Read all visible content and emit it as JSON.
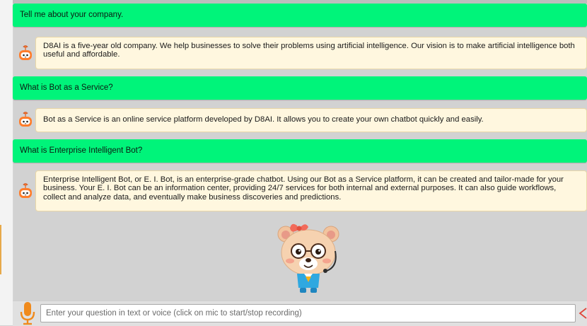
{
  "conversation": {
    "messages": [
      {
        "question": "Tell me about your company.",
        "answer": "D8AI is a five-year old company. We help businesses to solve their problems using artificial intelligence. Our vision is to make artificial intelligence both useful and affordable."
      },
      {
        "question": "What is Bot as a Service?",
        "answer": "Bot as a Service is an online service platform developed by D8AI. It allows you to create your own chatbot quickly and easily."
      },
      {
        "question": "What is Enterprise Intelligent Bot?",
        "answer": "Enterprise Intelligent Bot, or E. I. Bot, is an enterprise-grade chatbot. Using our Bot as a Service platform, it can be created and tailor-made for your business. Your E. I. Bot can be an information center, providing 24/7 services for both internal and external purposes. It can also guide workflows, collect and analyze data, and eventually make business discoveries and predictions."
      }
    ]
  },
  "input": {
    "placeholder": "Enter your question in text or voice (click on mic to start/stop recording)"
  },
  "icons": {
    "bot_avatar": "bot-avatar-icon",
    "mascot": "bear-mascot",
    "mic": "microphone-icon",
    "send": "send-arrow-icon"
  },
  "colors": {
    "question_bubble": "#00f47a",
    "answer_bubble": "#fff7df",
    "background": "#d2d2d2",
    "mic": "#f08a1c"
  }
}
